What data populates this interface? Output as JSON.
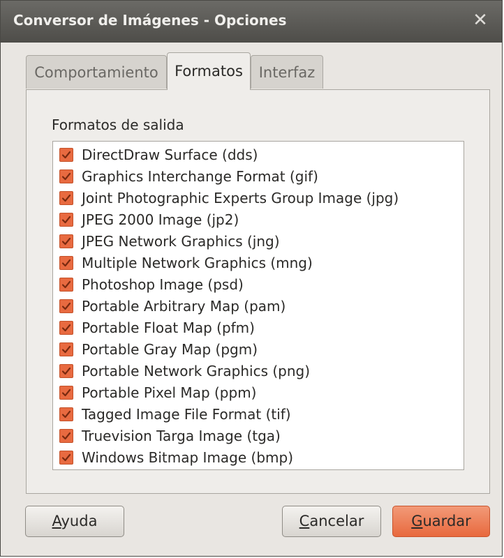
{
  "window": {
    "title": "Conversor de Imágenes - Opciones",
    "close_glyph": "✕"
  },
  "tabs": [
    {
      "label": "Comportamiento",
      "active": false
    },
    {
      "label": "Formatos",
      "active": true
    },
    {
      "label": "Interfaz",
      "active": false
    }
  ],
  "formats": {
    "section_label": "Formatos de salida",
    "items": [
      {
        "label": "DirectDraw Surface (dds)",
        "checked": true
      },
      {
        "label": "Graphics Interchange Format (gif)",
        "checked": true
      },
      {
        "label": "Joint Photographic Experts Group Image (jpg)",
        "checked": true
      },
      {
        "label": "JPEG 2000 Image (jp2)",
        "checked": true
      },
      {
        "label": "JPEG Network Graphics (jng)",
        "checked": true
      },
      {
        "label": "Multiple Network Graphics (mng)",
        "checked": true
      },
      {
        "label": "Photoshop Image (psd)",
        "checked": true
      },
      {
        "label": "Portable Arbitrary Map (pam)",
        "checked": true
      },
      {
        "label": "Portable Float Map (pfm)",
        "checked": true
      },
      {
        "label": "Portable Gray Map (pgm)",
        "checked": true
      },
      {
        "label": "Portable Network Graphics (png)",
        "checked": true
      },
      {
        "label": "Portable Pixel Map (ppm)",
        "checked": true
      },
      {
        "label": "Tagged Image File Format (tif)",
        "checked": true
      },
      {
        "label": "Truevision Targa Image (tga)",
        "checked": true
      },
      {
        "label": "Windows Bitmap Image (bmp)",
        "checked": true
      }
    ]
  },
  "buttons": {
    "help": {
      "accel": "A",
      "rest": "yuda"
    },
    "cancel": {
      "accel": "C",
      "rest": "ancelar"
    },
    "save": {
      "accel": "G",
      "rest": "uardar"
    }
  },
  "colors": {
    "accent": "#e8693e",
    "titlebar": "#4e4d49",
    "panel": "#efedea"
  }
}
